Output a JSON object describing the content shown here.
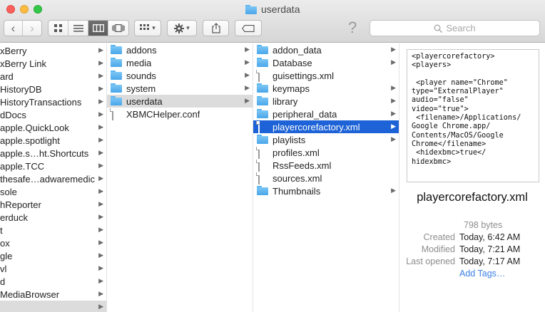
{
  "window": {
    "title": "userdata"
  },
  "toolbar": {
    "search_placeholder": "Search",
    "help_label": "?",
    "back_label": "‹",
    "forward_label": "›",
    "view_dropdown_label": "▾",
    "action_dropdown_label": "▾"
  },
  "column1": {
    "items": [
      {
        "name": "xBerry",
        "arrow": "▶"
      },
      {
        "name": "xBerry Link",
        "arrow": "▶"
      },
      {
        "name": "ard",
        "arrow": "▶"
      },
      {
        "name": "HistoryDB",
        "arrow": "▶"
      },
      {
        "name": "HistoryTransactions",
        "arrow": "▶"
      },
      {
        "name": "dDocs",
        "arrow": "▶"
      },
      {
        "name": "apple.QuickLook",
        "arrow": "▶"
      },
      {
        "name": "apple.spotlight",
        "arrow": "▶"
      },
      {
        "name": "apple.s…ht.Shortcuts",
        "arrow": "▶"
      },
      {
        "name": "apple.TCC",
        "arrow": "▶"
      },
      {
        "name": "thesafe…adwaremedic",
        "arrow": "▶"
      },
      {
        "name": "sole",
        "arrow": "▶"
      },
      {
        "name": "hReporter",
        "arrow": "▶"
      },
      {
        "name": "erduck",
        "arrow": "▶"
      },
      {
        "name": "t",
        "arrow": "▶"
      },
      {
        "name": "ox",
        "arrow": "▶"
      },
      {
        "name": "gle",
        "arrow": "▶"
      },
      {
        "name": "vl",
        "arrow": "▶"
      },
      {
        "name": "d",
        "arrow": "▶"
      },
      {
        "name": "MediaBrowser",
        "arrow": "▶"
      },
      {
        "name": "",
        "arrow": "▶"
      }
    ]
  },
  "column2": {
    "items": [
      {
        "name": "addons",
        "type": "folder",
        "arrow": "▶"
      },
      {
        "name": "media",
        "type": "folder",
        "arrow": "▶"
      },
      {
        "name": "sounds",
        "type": "folder",
        "arrow": "▶"
      },
      {
        "name": "system",
        "type": "folder",
        "arrow": "▶"
      },
      {
        "name": "userdata",
        "type": "folder",
        "arrow": "▶"
      },
      {
        "name": "XBMCHelper.conf",
        "type": "file",
        "arrow": ""
      }
    ]
  },
  "column3": {
    "items": [
      {
        "name": "addon_data",
        "type": "folder",
        "arrow": "▶"
      },
      {
        "name": "Database",
        "type": "folder",
        "arrow": "▶"
      },
      {
        "name": "guisettings.xml",
        "type": "file",
        "arrow": ""
      },
      {
        "name": "keymaps",
        "type": "folder",
        "arrow": "▶"
      },
      {
        "name": "library",
        "type": "folder",
        "arrow": "▶"
      },
      {
        "name": "peripheral_data",
        "type": "folder",
        "arrow": "▶"
      },
      {
        "name": "playercorefactory.xml",
        "type": "file",
        "arrow": "▶"
      },
      {
        "name": "playlists",
        "type": "folder",
        "arrow": "▶"
      },
      {
        "name": "profiles.xml",
        "type": "file",
        "arrow": ""
      },
      {
        "name": "RssFeeds.xml",
        "type": "file",
        "arrow": ""
      },
      {
        "name": "sources.xml",
        "type": "file",
        "arrow": ""
      },
      {
        "name": "Thumbnails",
        "type": "folder",
        "arrow": "▶"
      }
    ]
  },
  "preview": {
    "code": "<playercorefactory>\n<players>\n\n <player name=\"Chrome\"\ntype=\"ExternalPlayer\"\naudio=\"false\"\nvideo=\"true\">\n <filename>/Applications/\nGoogle Chrome.app/\nContents/MacOS/Google\nChrome</filename>\n <hidexbmc>true</\nhidexbmc>",
    "filename": "playercorefactory.xml",
    "size": "798 bytes",
    "created_label": "Created",
    "created_value": "Today, 6:42 AM",
    "modified_label": "Modified",
    "modified_value": "Today, 7:21 AM",
    "last_opened_label": "Last opened",
    "last_opened_value": "Today, 7:17 AM",
    "tags_label": "Add Tags…"
  },
  "colors": {
    "selection": "#1d62d6",
    "accent_link": "#3a7fe3",
    "folder": "#5ab3ef"
  }
}
